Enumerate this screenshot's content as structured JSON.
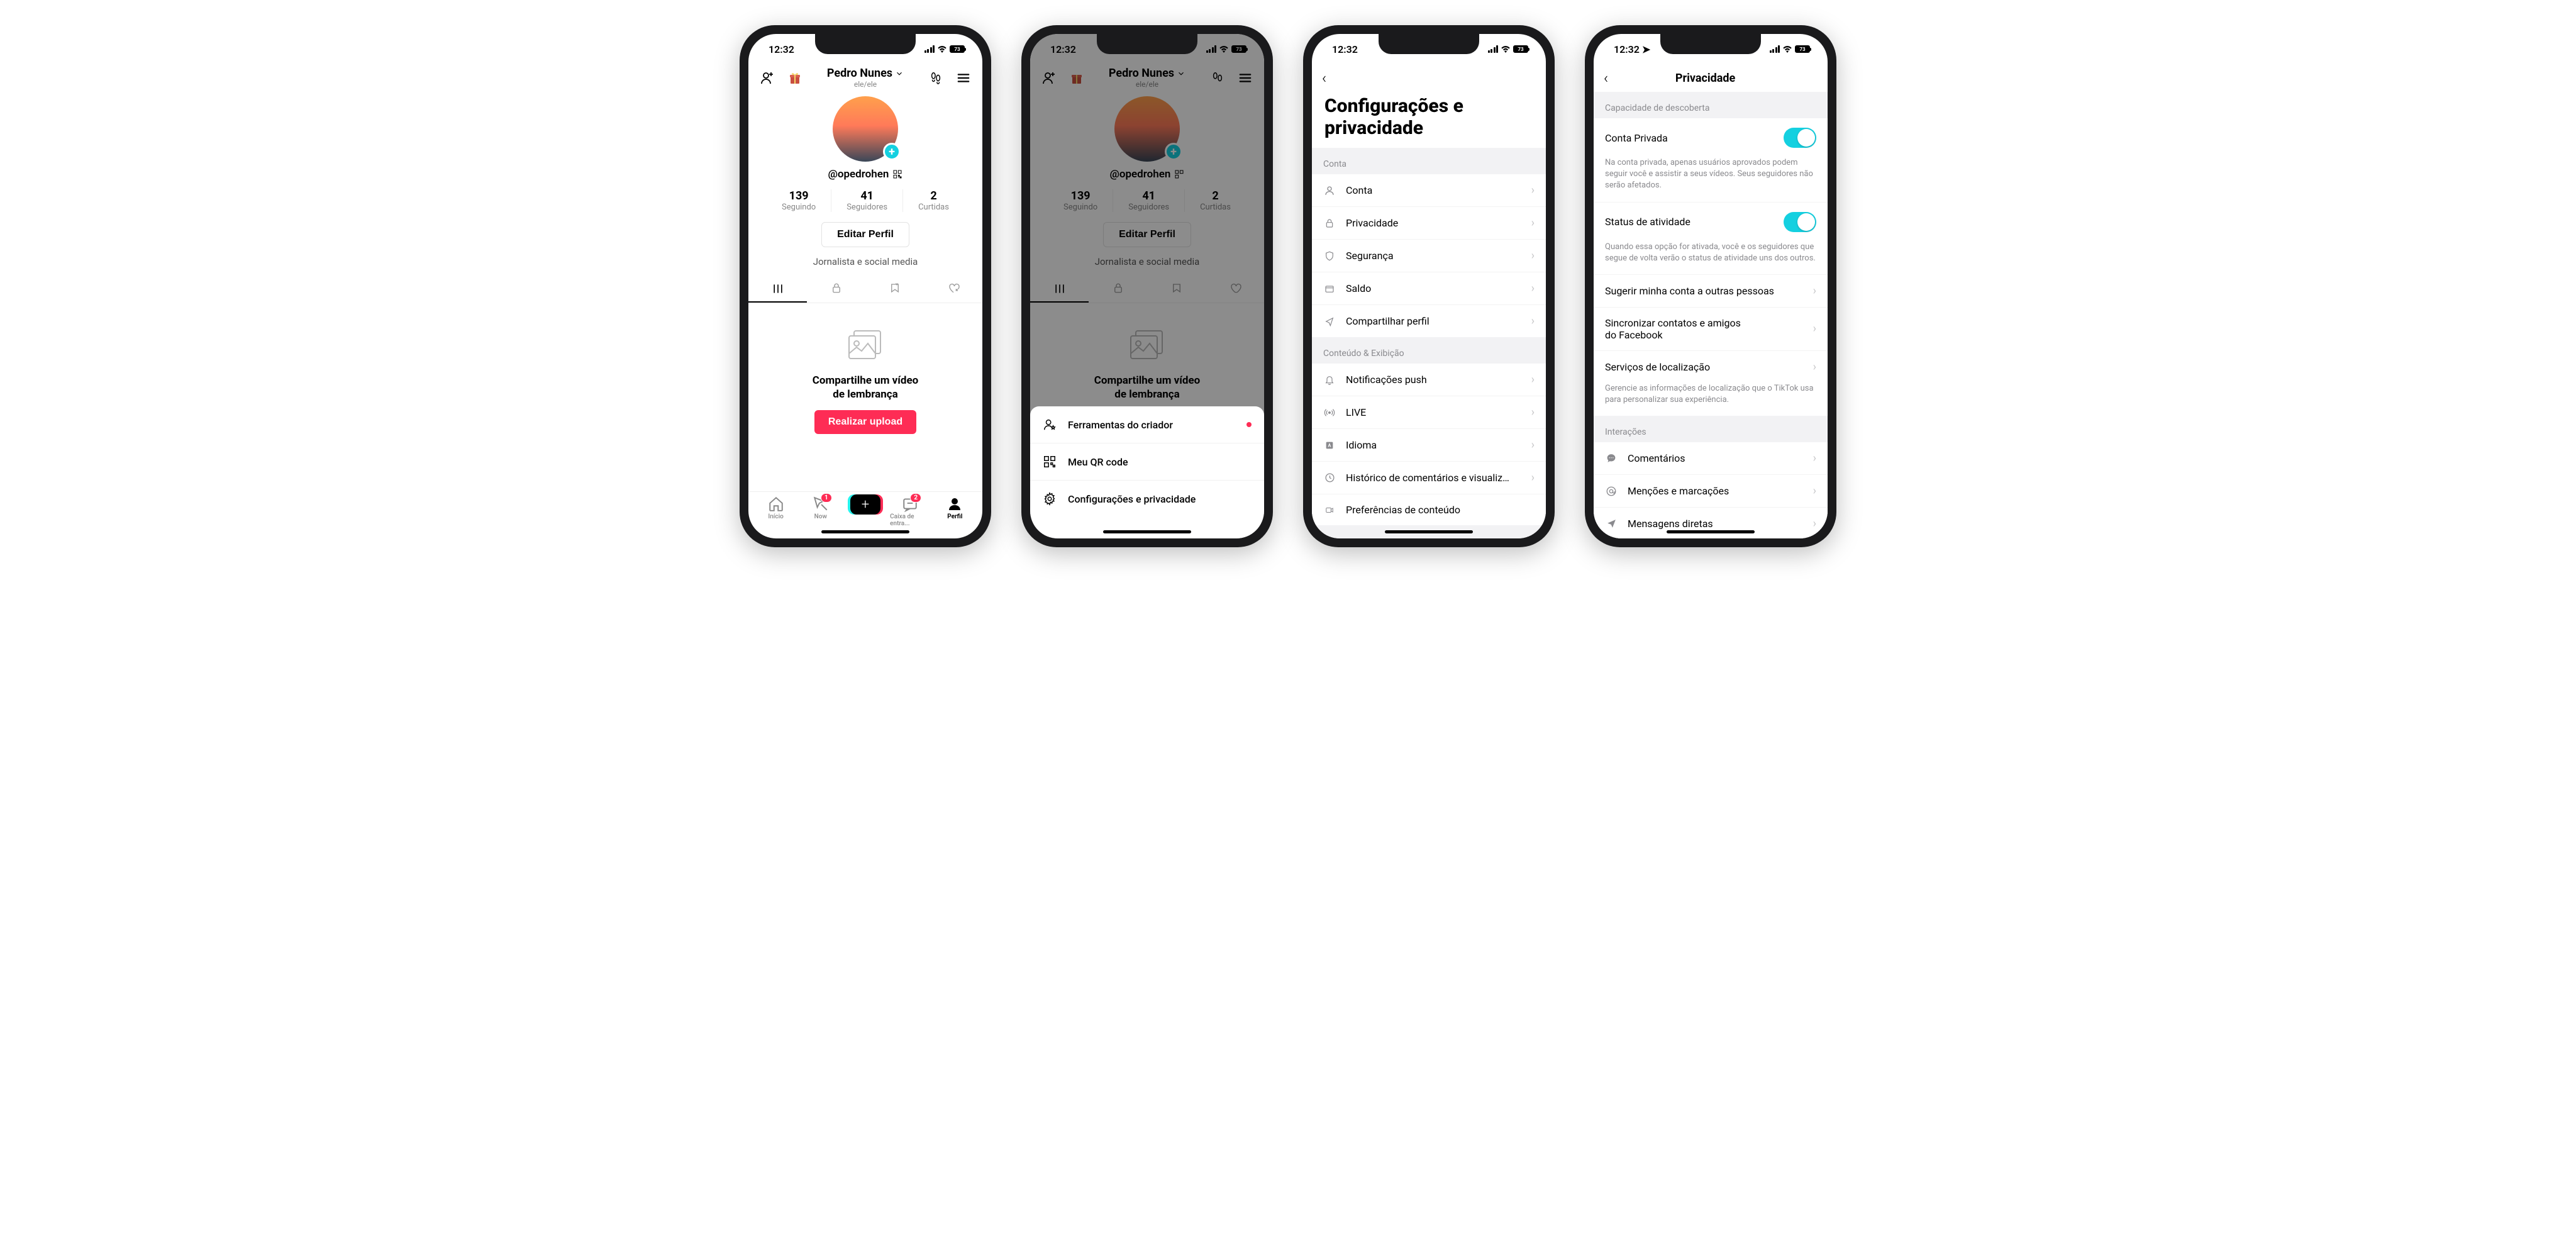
{
  "status": {
    "time": "12:32",
    "battery": "73"
  },
  "screen1": {
    "name": "Pedro Nunes",
    "pronouns": "ele/ele",
    "handle": "@opedrohen",
    "stats": {
      "following_num": "139",
      "following_lab": "Seguindo",
      "followers_num": "41",
      "followers_lab": "Seguidores",
      "likes_num": "2",
      "likes_lab": "Curtidas"
    },
    "edit": "Editar Perfil",
    "bio": "Jornalista e social media",
    "empty_title": "Compartilhe um vídeo\nde lembrança",
    "upload": "Realizar upload",
    "nav": {
      "home": "Início",
      "now": "Now",
      "inbox": "Caixa de entra...",
      "profile": "Perfil",
      "now_badge": "1",
      "inbox_badge": "2"
    }
  },
  "screen2": {
    "sheet": {
      "creator": "Ferramentas do criador",
      "qr": "Meu QR code",
      "settings": "Configurações e privacidade"
    }
  },
  "screen3": {
    "title": "Configurações e\nprivacidade",
    "sec_account": "Conta",
    "rows_account": {
      "account": "Conta",
      "privacy": "Privacidade",
      "security": "Segurança",
      "balance": "Saldo",
      "share": "Compartilhar perfil"
    },
    "sec_content": "Conteúdo & Exibição",
    "rows_content": {
      "push": "Notificações push",
      "live": "LIVE",
      "lang": "Idioma",
      "history": "Histórico de comentários e visualiza...",
      "prefs": "Preferências de conteúdo"
    }
  },
  "screen4": {
    "title": "Privacidade",
    "sec_discover": "Capacidade de descoberta",
    "private_label": "Conta Privada",
    "private_desc": "Na conta privada, apenas usuários aprovados podem seguir você e assistir a seus vídeos. Seus seguidores não serão afetados.",
    "activity_label": "Status de atividade",
    "activity_desc": "Quando essa opção for ativada, você e os seguidores que segue de volta verão o status de atividade uns dos outros.",
    "suggest": "Sugerir minha conta a outras pessoas",
    "sync": "Sincronizar contatos e amigos\ndo Facebook",
    "location": "Serviços de localização",
    "location_desc": "Gerencie as informações de localização que o TikTok usa para personalizar sua experiência.",
    "sec_interactions": "Interações",
    "comments": "Comentários",
    "mentions": "Menções e marcações",
    "dm": "Mensagens diretas"
  }
}
